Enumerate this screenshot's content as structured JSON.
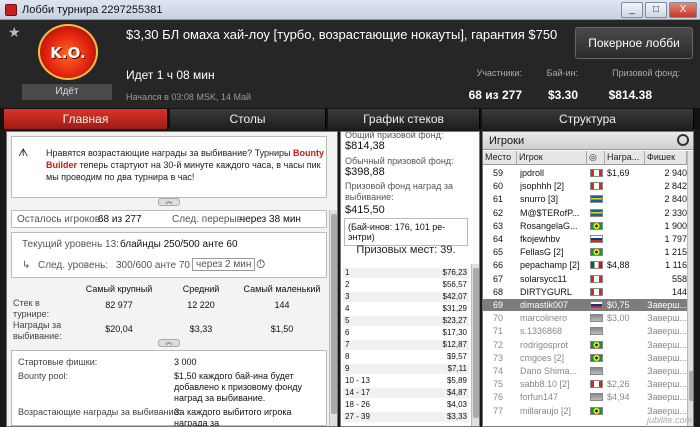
{
  "window": {
    "title": "Лобби турнира 2297255381",
    "btn_min": "_",
    "btn_max": "□",
    "btn_close": "X"
  },
  "header": {
    "title": "$3,30 БЛ омаха хай-лоу [турбо, возрастающие нокауты], гарантия $750",
    "logo_text": "K.O.",
    "status": "Идёт",
    "state": "Идет 1 ч 08 мин",
    "started": "Начался в 03:08 MSK, 14 Май",
    "lobby_button": "Покерное лобби",
    "stats": [
      {
        "label": "Участники:",
        "value": "68 из 277"
      },
      {
        "label": "Бай-ин:",
        "value": "$3.30"
      },
      {
        "label": "Призовой фонд:",
        "value": "$814.38"
      }
    ]
  },
  "tabs": [
    {
      "label": "Главная",
      "active": true
    },
    {
      "label": "Столы",
      "active": false
    },
    {
      "label": "График стеков",
      "active": false
    },
    {
      "label": "Структура",
      "active": false
    }
  ],
  "main": {
    "notice_pre": "Нравятся возрастающие награды за выбивание? Турниры ",
    "notice_brand": "Bounty Builder",
    "notice_post": " теперь стартуют на 30-й минуте каждого часа, в часы пик мы проводим по два турнира в час!",
    "remaining_label": "Осталось игроков:",
    "remaining_value": "68 из 277",
    "break_label": "След. перерыв:",
    "break_value": "через 38 мин",
    "level_label": "Текущий уровень 13:",
    "level_value": "блайнды 250/500 анте 60",
    "next_level_label": "След. уровень:",
    "next_level_value": "300/600 анте 70",
    "next_level_time": "через 2 мин",
    "stack_headers": [
      "Самый крупный",
      "Средний",
      "Самый маленький"
    ],
    "stack_row_label": "Стек в турнире:",
    "stack_values": [
      "82 977",
      "12 220",
      "144"
    ],
    "bounty_row_label": "Награды за выбивание:",
    "bounty_values": [
      "$20,04",
      "$3,33",
      "$1,50"
    ],
    "chips_label": "Стартовые фишки:",
    "chips_value": "3 000",
    "pool_label": "Bounty pool:",
    "pool_value": "$1,50 каждого бай-ина будет добавлено к призовому фонду наград за выбивание.",
    "ko_label": "Возрастающие награды за выбивание:",
    "ko_value": "За каждого выбитого игрока награда за"
  },
  "prizes": {
    "total_label": "Общий призовой фонд:",
    "total_value": "$814,38",
    "regular_label": "Обычный призовой фонд:",
    "regular_value": "$398,88",
    "bounty_label": "Призовой фонд наград за выбивание:",
    "bounty_value": "$415,50",
    "buyins_note": "(Бай-инов: 176, 101 ре-энтри)",
    "paid_label": "Призовых мест: 39.",
    "rows": [
      {
        "place": "1",
        "amount": "$76,23"
      },
      {
        "place": "2",
        "amount": "$56,57"
      },
      {
        "place": "3",
        "amount": "$42,07"
      },
      {
        "place": "4",
        "amount": "$31,29"
      },
      {
        "place": "5",
        "amount": "$23,27"
      },
      {
        "place": "6",
        "amount": "$17,30"
      },
      {
        "place": "7",
        "amount": "$12,87"
      },
      {
        "place": "8",
        "amount": "$9,57"
      },
      {
        "place": "9",
        "amount": "$7,11"
      },
      {
        "place": "10 - 13",
        "amount": "$5,89"
      },
      {
        "place": "14 - 17",
        "amount": "$4,87"
      },
      {
        "place": "18 - 26",
        "amount": "$4,03"
      },
      {
        "place": "27 - 39",
        "amount": "$3,33"
      }
    ]
  },
  "players": {
    "title": "Игроки",
    "columns": [
      "Место",
      "Игрок",
      "",
      "Награ...",
      "Фишек"
    ],
    "rows": [
      {
        "place": "59",
        "name": "jpdroll",
        "flag": "ca",
        "bounty": "$1,69",
        "chips": "2 940"
      },
      {
        "place": "60",
        "name": "jsophhh [2]",
        "flag": "ca",
        "bounty": "",
        "chips": "2 842"
      },
      {
        "place": "61",
        "name": "snurro [3]",
        "flag": "se",
        "bounty": "",
        "chips": "2 840"
      },
      {
        "place": "62",
        "name": "M@$TERofP...",
        "flag": "se",
        "bounty": "",
        "chips": "2 330"
      },
      {
        "place": "63",
        "name": "RosangelaG...",
        "flag": "br",
        "bounty": "",
        "chips": "1 900"
      },
      {
        "place": "64",
        "name": "fkojewhbv",
        "flag": "ru",
        "bounty": "",
        "chips": "1 797"
      },
      {
        "place": "65",
        "name": "FellasG [2]",
        "flag": "br",
        "bounty": "",
        "chips": "1 215"
      },
      {
        "place": "66",
        "name": "pepachamp [2]",
        "flag": "mx",
        "bounty": "$4,88",
        "chips": "1 116"
      },
      {
        "place": "67",
        "name": "solarsycc11",
        "flag": "ca",
        "bounty": "",
        "chips": "558"
      },
      {
        "place": "68",
        "name": "DIRTYGURL",
        "flag": "ca",
        "bounty": "",
        "chips": "144"
      },
      {
        "place": "69",
        "name": "dimastik007",
        "flag": "ru",
        "bounty": "$0,75",
        "chips": "Заверш..."
      },
      {
        "place": "70",
        "name": "marcolinero",
        "flag": "gr",
        "bounty": "$3,00",
        "chips": "Заверш..."
      },
      {
        "place": "71",
        "name": "s.1336868",
        "flag": "gr",
        "bounty": "",
        "chips": "Заверш..."
      },
      {
        "place": "72",
        "name": "rodrigosprot",
        "flag": "br",
        "bounty": "",
        "chips": "Заверш..."
      },
      {
        "place": "73",
        "name": "cmgoes [2]",
        "flag": "br",
        "bounty": "",
        "chips": "Заверш..."
      },
      {
        "place": "74",
        "name": "Dano Shima...",
        "flag": "gr",
        "bounty": "",
        "chips": "Заверш..."
      },
      {
        "place": "75",
        "name": "sabb8.10 [2]",
        "flag": "ca",
        "bounty": "$2,26",
        "chips": "Заверш..."
      },
      {
        "place": "76",
        "name": "forfun147",
        "flag": "gr",
        "bounty": "$4,94",
        "chips": "Заверш..."
      },
      {
        "place": "77",
        "name": "millaraujo [2]",
        "flag": "br",
        "bounty": "",
        "chips": "Заверш..."
      }
    ]
  },
  "watermark": "jubilite.com",
  "colors": {
    "accent": "#c0281e",
    "selected_row": "#7d7d7d"
  }
}
